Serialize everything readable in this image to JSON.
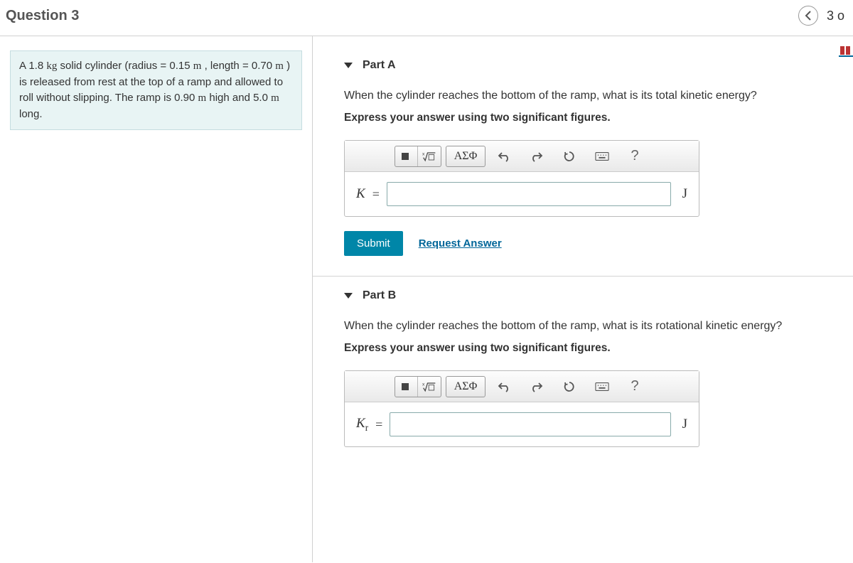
{
  "header": {
    "title": "Question 3",
    "page_indicator": "3 o"
  },
  "problem": {
    "text_prefix": "A 1.8 ",
    "unit_kg": "kg",
    "text_mid1": " solid cylinder (radius = 0.15 ",
    "unit_m1": "m",
    "text_mid2": " , length = 0.70 ",
    "unit_m2": "m",
    "text_mid3": " ) is released from rest at the top of a ramp and allowed to roll without slipping. The ramp is 0.90 ",
    "unit_m3": "m",
    "text_mid4": " high and 5.0 ",
    "unit_m4": "m",
    "text_end": " long."
  },
  "parts": {
    "a": {
      "title": "Part A",
      "question": "When the cylinder reaches the bottom of the ramp, what is its total kinetic energy?",
      "instruction": "Express your answer using two significant figures.",
      "variable": "K",
      "equals": "=",
      "unit": "J",
      "value": "",
      "submit_label": "Submit",
      "request_label": "Request Answer"
    },
    "b": {
      "title": "Part B",
      "question": "When the cylinder reaches the bottom of the ramp, what is its rotational kinetic energy?",
      "instruction": "Express your answer using two significant figures.",
      "variable_html": "K",
      "variable_sub": "r",
      "equals": "=",
      "unit": "J",
      "value": ""
    }
  },
  "toolbar": {
    "greek_label": "ΑΣΦ",
    "help_label": "?"
  }
}
